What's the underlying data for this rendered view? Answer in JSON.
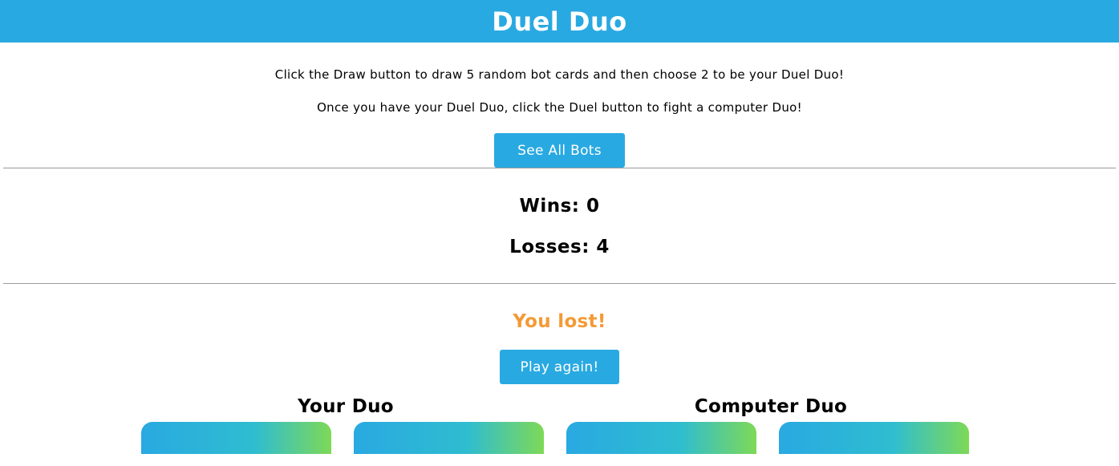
{
  "header": {
    "title": "Duel Duo"
  },
  "intro": {
    "line1": "Click the Draw button to draw 5 random bot cards and then choose 2 to be your Duel Duo!",
    "line2": "Once you have your Duel Duo, click the Duel button to fight a computer Duo!",
    "see_all_label": "See All Bots"
  },
  "stats": {
    "wins": "Wins: 0",
    "losses": "Losses: 4"
  },
  "result": {
    "message": "You lost!",
    "play_again_label": "Play again!"
  },
  "duos": {
    "your_title": "Your Duo",
    "computer_title": "Computer Duo"
  },
  "colors": {
    "primary": "#29a9e1",
    "result_text": "#f39a36",
    "card_gradient_end": "#7ed957"
  }
}
